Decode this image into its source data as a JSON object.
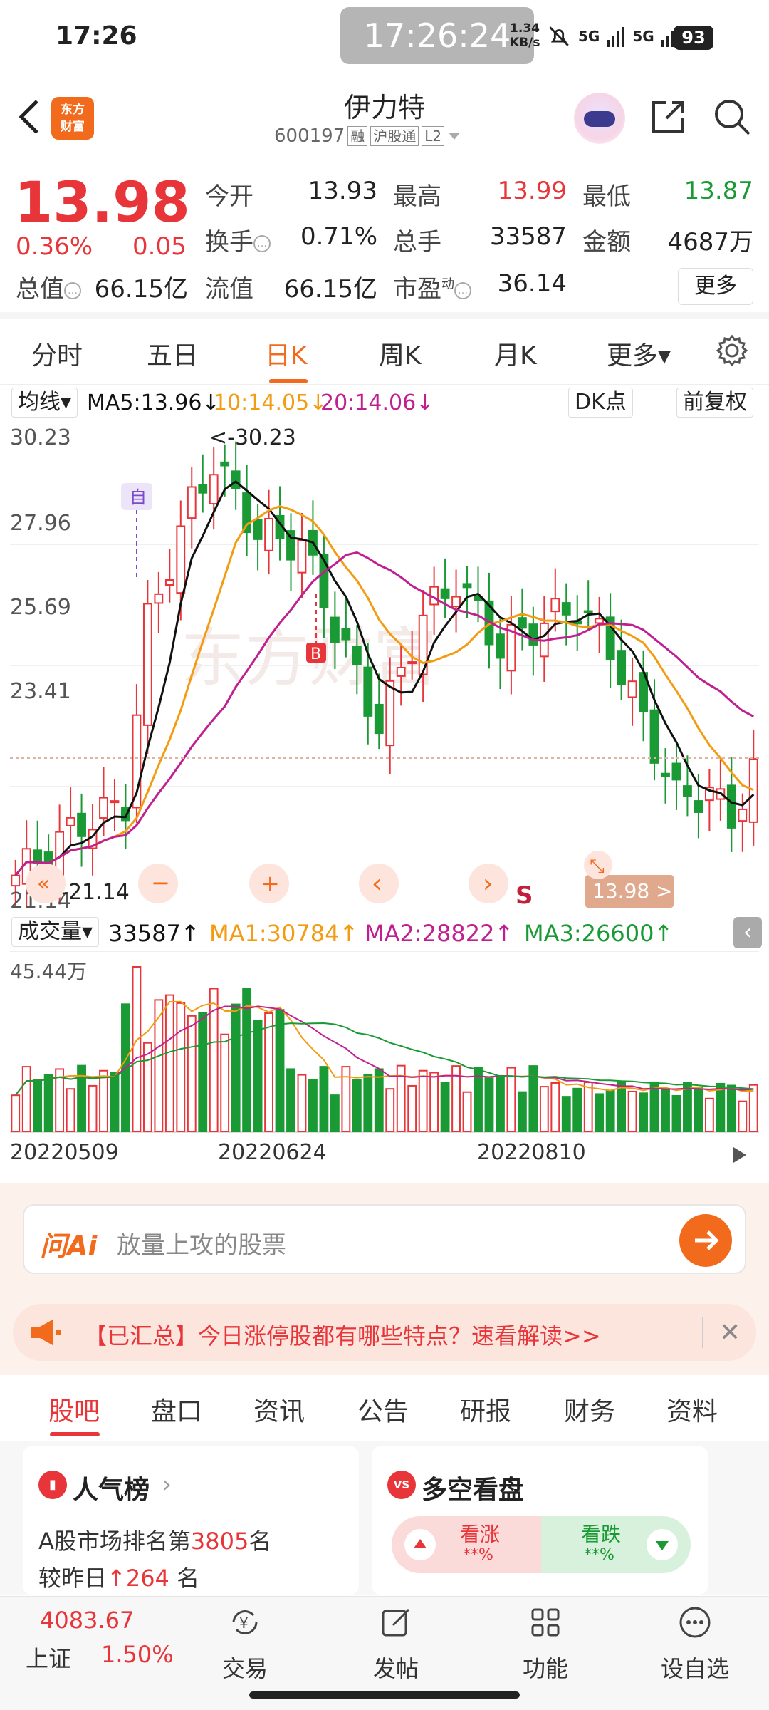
{
  "status_bar": {
    "time": "17:26",
    "center_clock": "17:26:24",
    "net_speed_value": "1.34",
    "net_speed_unit": "KB/s",
    "signal1": "5G",
    "signal2": "5G",
    "battery": "93"
  },
  "header": {
    "logo_line1": "东方",
    "logo_line2": "财富",
    "stock_name": "伊力特",
    "stock_code": "600197",
    "tag_margin": "融",
    "tag_connect": "沪股通",
    "tag_level": "L2"
  },
  "quote": {
    "price": "13.98",
    "pct_change": "0.36%",
    "abs_change": "0.05",
    "open_label": "今开",
    "open_value": "13.93",
    "high_label": "最高",
    "high_value": "13.99",
    "low_label": "最低",
    "low_value": "13.87",
    "turnover_label": "换手",
    "turnover_value": "0.71%",
    "volume_label": "总手",
    "volume_value": "33587",
    "amount_label": "金额",
    "amount_value": "4687万",
    "mktcap_label": "总值",
    "mktcap_value": "66.15亿",
    "float_label": "流值",
    "float_value": "66.15亿",
    "pe_label": "市盈",
    "pe_sup": "动",
    "pe_value": "36.14",
    "more_label": "更多"
  },
  "period_tabs": [
    {
      "label": "分时"
    },
    {
      "label": "五日"
    },
    {
      "label": "日K"
    },
    {
      "label": "周K"
    },
    {
      "label": "月K"
    },
    {
      "label": "更多▾"
    }
  ],
  "ma_row": {
    "selector": "均线▾",
    "ma5": "MA5:13.96↓",
    "ma10": "10:14.05↓",
    "ma20": "20:14.06↓",
    "dk_label": "DK点",
    "restore_label": "前复权"
  },
  "kline": {
    "y_labels": [
      "30.23",
      "27.96",
      "25.69",
      "23.41",
      "21.14"
    ],
    "high_marker": "<-30.23",
    "low_marker": "<-21.14",
    "zi_marker": "自",
    "b_marker": "B",
    "s_marker": "S",
    "watermark": "东方财富",
    "current_tag": "13.98 >",
    "ctrl_first": "«",
    "ctrl_zoom_out": "−",
    "ctrl_zoom_in": "+",
    "ctrl_prev": "‹",
    "ctrl_next": "›",
    "ctrl_fullscreen": "⤡"
  },
  "volume": {
    "selector": "成交量▾",
    "current": "33587↑",
    "ma1": "MA1:30784↑",
    "ma2": "MA2:28822↑",
    "ma3": "MA3:26600↑",
    "max_label": "45.44万",
    "dates": [
      "20220509",
      "20220624",
      "20220810"
    ]
  },
  "ai": {
    "logo": "问Ai",
    "placeholder": "放量上攻的股票"
  },
  "notice": {
    "text": "【已汇总】今日涨停股都有哪些特点？速看解读>>",
    "close": "✕"
  },
  "sub_tabs": [
    {
      "label": "股吧"
    },
    {
      "label": "盘口"
    },
    {
      "label": "资讯"
    },
    {
      "label": "公告"
    },
    {
      "label": "研报"
    },
    {
      "label": "财务"
    },
    {
      "label": "资料"
    }
  ],
  "cards": {
    "popularity_title": "人气榜",
    "popularity_line1_prefix": "A股市场排名第",
    "popularity_rank": "3805",
    "popularity_line1_suffix": "名",
    "popularity_line2_prefix": "较昨日",
    "popularity_delta": "↑264",
    "popularity_line2_suffix": "名",
    "sentiment_icon": "VS",
    "sentiment_title": "多空看盘",
    "bull_label": "看涨",
    "bull_value": "**%",
    "bear_label": "看跌",
    "bear_value": "**%"
  },
  "bottom_nav": {
    "index_value": "4083.67",
    "index_name": "上证",
    "index_pct": "1.50%",
    "trade": "交易",
    "post": "发帖",
    "func": "功能",
    "watch": "设自选"
  },
  "colors": {
    "up": "#e8353a",
    "down": "#1a9a34",
    "accent": "#f26b1d",
    "ma5": "#111111",
    "ma10": "#f39c12",
    "ma20": "#c0208f"
  }
}
